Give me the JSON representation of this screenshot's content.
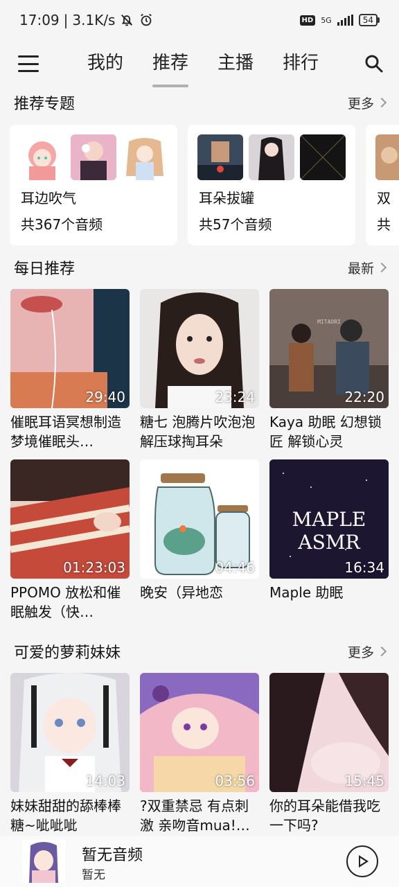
{
  "status_bar": {
    "time": "17:09",
    "speed": "3.1K/s",
    "hd": "HD",
    "network": "5G",
    "battery": "54"
  },
  "nav": {
    "tabs": [
      {
        "label": "我的"
      },
      {
        "label": "推荐"
      },
      {
        "label": "主播"
      },
      {
        "label": "排行"
      }
    ],
    "active_tab": "推荐"
  },
  "sections": {
    "topics": {
      "title": "推荐专题",
      "more": "更多"
    },
    "daily": {
      "title": "每日推荐",
      "more": "最新"
    },
    "loli": {
      "title": "可爱的萝莉妹妹",
      "more": "更多"
    }
  },
  "topics": [
    {
      "name": "耳边吹气",
      "count": "共367个音频"
    },
    {
      "name": "耳朵拔罐",
      "count": "共57个音频"
    },
    {
      "name": "双",
      "count": "共"
    }
  ],
  "daily_videos": [
    {
      "title": "催眠耳语冥想制造梦境催眠头…",
      "duration": "29:40"
    },
    {
      "title": "糖七 泡腾片吹泡泡解压球掏耳朵",
      "duration": "23:24"
    },
    {
      "title": "Kaya 助眠 幻想锁匠 解锁心灵",
      "duration": "22:20"
    },
    {
      "title": "PPOMO 放松和催眠触发（快…",
      "duration": "01:23:03"
    },
    {
      "title": "晚安（异地恋",
      "duration": "04:46"
    },
    {
      "title": "Maple 助眠",
      "duration": "16:34"
    }
  ],
  "thumb_text": {
    "maple": "MAPLE ASMR",
    "mitaori": "MITAORI\nASMR"
  },
  "loli_videos": [
    {
      "title": "妹妹甜甜的舔棒棒糖~呲呲呲",
      "duration": "14:03"
    },
    {
      "title": "?双重禁忌 有点刺激 亲吻音mua!…",
      "duration": "03:56"
    },
    {
      "title": "你的耳朵能借我吃一下吗?",
      "duration": "15:45"
    }
  ],
  "player": {
    "title": "暂无音频",
    "subtitle": "暂无"
  },
  "colors": {
    "background": "#f5f5f5",
    "card": "#ffffff",
    "tab_indicator": "#b0b0b0"
  }
}
